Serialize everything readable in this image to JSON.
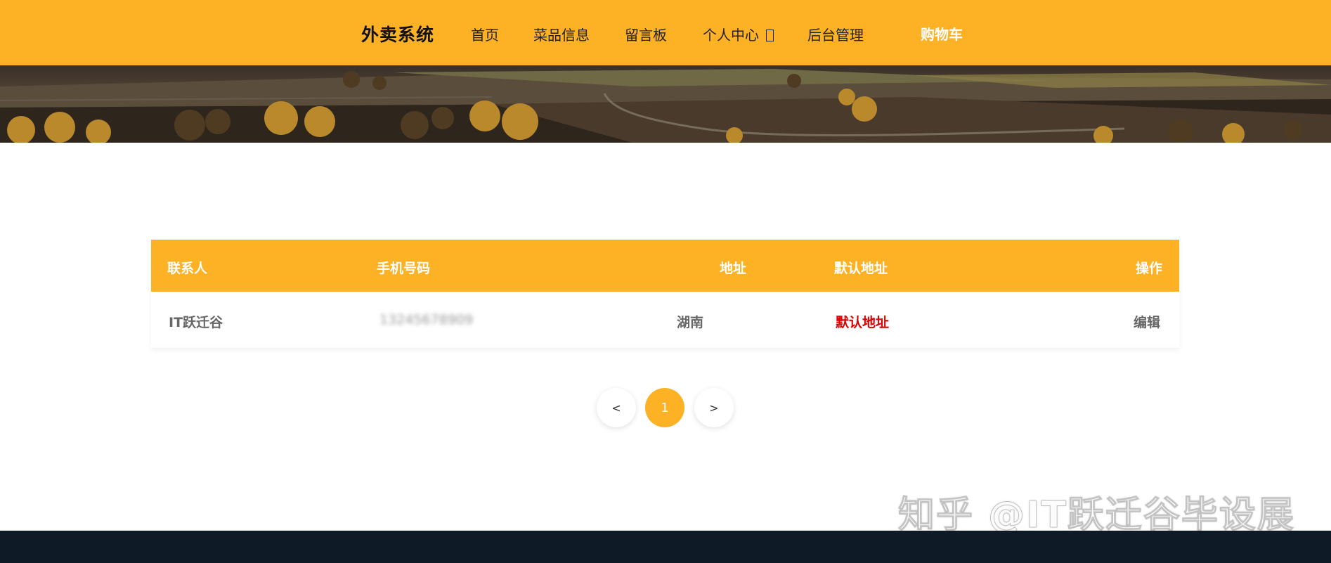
{
  "header": {
    "brand": "外卖系统",
    "nav": {
      "home": "首页",
      "dishes": "菜品信息",
      "message_board": "留言板",
      "personal_center": "个人中心",
      "admin": "后台管理",
      "cart": "购物车"
    }
  },
  "table": {
    "headers": {
      "contact": "联系人",
      "phone": "手机号码",
      "address": "地址",
      "default_address": "默认地址",
      "actions": "操作"
    },
    "rows": [
      {
        "contact": "IT跃迁谷",
        "phone": "13245678909",
        "address": "湖南",
        "default_address": "默认地址",
        "action": "编辑"
      }
    ]
  },
  "pagination": {
    "prev": "<",
    "current": "1",
    "next": ">"
  },
  "watermark": "知乎 @IT跃迁谷毕设展",
  "colors": {
    "accent": "#fdb124",
    "default_address_text": "#dd0000",
    "footer": "#0f1a27"
  }
}
